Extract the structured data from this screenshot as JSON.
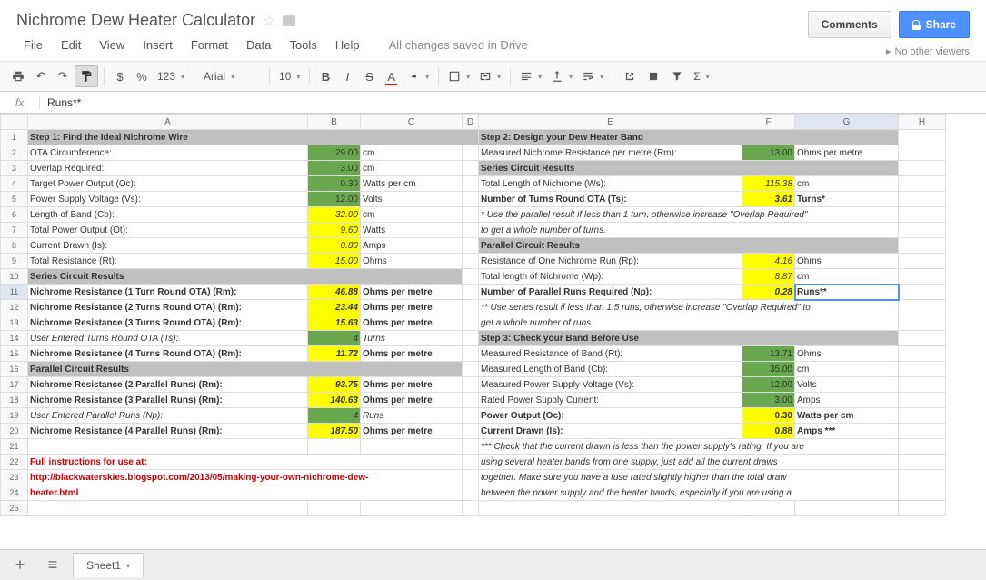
{
  "doc": {
    "title": "Nichrome Dew Heater Calculator",
    "saved": "All changes saved in Drive"
  },
  "menu": {
    "file": "File",
    "edit": "Edit",
    "view": "View",
    "insert": "Insert",
    "format": "Format",
    "data": "Data",
    "tools": "Tools",
    "help": "Help"
  },
  "btns": {
    "comments": "Comments",
    "share": "Share",
    "viewers": "No other viewers"
  },
  "tb": {
    "curr": "$",
    "pct": "%",
    "dec": "123",
    "font": "Arial",
    "size": "10"
  },
  "fx": {
    "label": "fx",
    "value": "Runs**"
  },
  "tabs": {
    "sheet1": "Sheet1"
  },
  "rows": {
    "r1": {
      "a": "Step 1: Find the Ideal Nichrome Wire",
      "e": "Step 2: Design your Dew Heater Band"
    },
    "r2": {
      "a": "OTA Circumference:",
      "b": "29.00",
      "c": "cm",
      "e": "Measured Nichrome Resistance per metre (Rm):",
      "f": "13.00",
      "g": "Ohms per metre"
    },
    "r3": {
      "a": "Overlap Required:",
      "b": "3.00",
      "c": "cm",
      "e": "Series Circuit Results"
    },
    "r4": {
      "a": "Target Power Output (Oc):",
      "b": "0.30",
      "c": "Watts per cm",
      "e": "Total Length of Nichrome (Ws):",
      "f": "115.38",
      "g": "cm"
    },
    "r5": {
      "a": "Power Supply Voltage (Vs):",
      "b": "12.00",
      "c": "Volts",
      "e": "Number of Turns Round OTA (Ts):",
      "f": "3.61",
      "g": "Turns*"
    },
    "r6": {
      "a": "Length of Band (Cb):",
      "b": "32.00",
      "c": "cm",
      "e": "* Use the parallel result if less than 1 turn, otherwise increase \"Overlap Required\""
    },
    "r7": {
      "a": "Total Power Output (Ot):",
      "b": "9.60",
      "c": "Watts",
      "e": "to get a whole number of turns."
    },
    "r8": {
      "a": "Current Drawn (Is):",
      "b": "0.80",
      "c": "Amps",
      "e": "Parallel Circuit Results"
    },
    "r9": {
      "a": "Total Resistance (Rt):",
      "b": "15.00",
      "c": "Ohms",
      "e": "Resistance of One Nichrome Run (Rp):",
      "f": "4.16",
      "g": "Ohms"
    },
    "r10": {
      "a": "Series Circuit Results",
      "e": "Total length of Nichrome (Wp):",
      "f": "8.87",
      "g": "cm"
    },
    "r11": {
      "a": "Nichrome Resistance (1 Turn Round OTA) (Rm):",
      "b": "46.88",
      "c": "Ohms per metre",
      "e": "Number of Parallel Runs Required (Np):",
      "f": "0.28",
      "g": "Runs**"
    },
    "r12": {
      "a": "Nichrome Resistance (2 Turns Round OTA) (Rm):",
      "b": "23.44",
      "c": "Ohms per metre",
      "e": "** Use series result if less than 1.5 runs, otherwise increase \"Overlap Required\" to"
    },
    "r13": {
      "a": "Nichrome Resistance (3 Turns Round OTA) (Rm):",
      "b": "15.63",
      "c": "Ohms per metre",
      "e": "get a whole number of runs."
    },
    "r14": {
      "a": "User Entered Turns Round OTA (Ts):",
      "b": "4",
      "c": "Turns",
      "e": "Step 3: Check your Band Before Use"
    },
    "r15": {
      "a": "Nichrome Resistance (4 Turns Round OTA) (Rm):",
      "b": "11.72",
      "c": "Ohms per metre",
      "e": "Measured Resistance of Band (Rt):",
      "f": "13.71",
      "g": "Ohms"
    },
    "r16": {
      "a": "Parallel Circuit Results",
      "e": "Measured Length of Band (Cb):",
      "f": "35.00",
      "g": "cm"
    },
    "r17": {
      "a": "Nichrome Resistance (2 Parallel Runs) (Rm):",
      "b": "93.75",
      "c": "Ohms per metre",
      "e": "Measured Power Supply Voltage (Vs):",
      "f": "12.00",
      "g": "Volts"
    },
    "r18": {
      "a": "Nichrome Resistance (3 Parallel Runs) (Rm):",
      "b": "140.63",
      "c": "Ohms per metre",
      "e": "Rated Power Supply Current:",
      "f": "3.00",
      "g": "Amps"
    },
    "r19": {
      "a": "User Entered Parallel Runs (Np):",
      "b": "4",
      "c": "Runs",
      "e": "Power Output (Oc):",
      "f": "0.30",
      "g": "Watts per cm"
    },
    "r20": {
      "a": "Nichrome Resistance (4 Parallel Runs) (Rm):",
      "b": "187.50",
      "c": "Ohms per metre",
      "e": "Current Drawn (Is):",
      "f": "0.88",
      "g": "Amps ***"
    },
    "r21": {
      "e": "*** Check that the current drawn is less than the power supply's rating. If you are"
    },
    "r22": {
      "a": "Full instructions for use at:",
      "e": "using several heater bands from one supply, just add all the current draws"
    },
    "r23": {
      "a": "http://blackwaterskies.blogspot.com/2013/05/making-your-own-nichrome-dew-",
      "e": "together. Make sure you have a fuse rated slightly higher than the total draw"
    },
    "r24": {
      "a": "heater.html",
      "e": "between the power supply and the heater bands, especially if you are using a"
    }
  }
}
